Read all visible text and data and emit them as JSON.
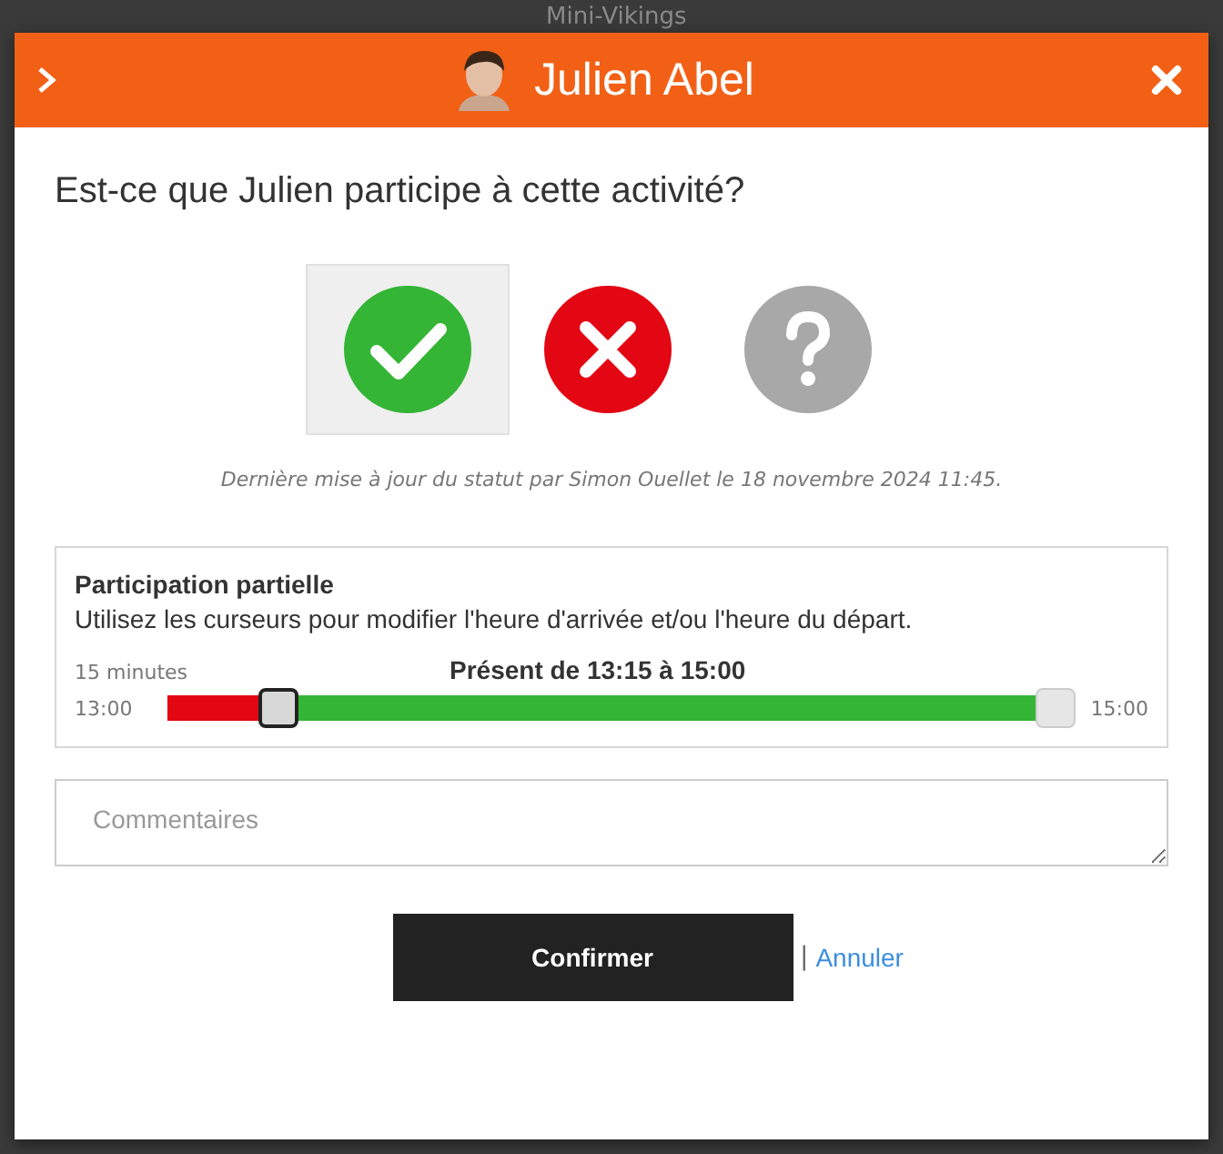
{
  "backdrop": {
    "title": "Mini-Vikings"
  },
  "dialog": {
    "name": "Julien Abel",
    "question": "Est-ce que Julien participe à cette activité?",
    "statuses": [
      {
        "kind": "yes",
        "selected": true
      },
      {
        "kind": "no",
        "selected": false
      },
      {
        "kind": "unknown",
        "selected": false
      }
    ],
    "last_update": "Dernière mise à jour du statut par Simon Ouellet le 18 novembre 2024 11:45.",
    "partial": {
      "title": "Participation partielle",
      "hint": "Utilisez les curseurs pour modifier l'heure d'arrivée et/ou l'heure du départ.",
      "step": "15 minutes",
      "summary": "Présent de 13:15 à 15:00",
      "min_label": "13:00",
      "max_label": "15:00",
      "start": {
        "level": 0.125
      },
      "end": {
        "level": 1
      }
    },
    "comment": {
      "placeholder": "Commentaires"
    },
    "confirm": "Confirmer",
    "separator": "|",
    "cancel": "Annuler"
  }
}
